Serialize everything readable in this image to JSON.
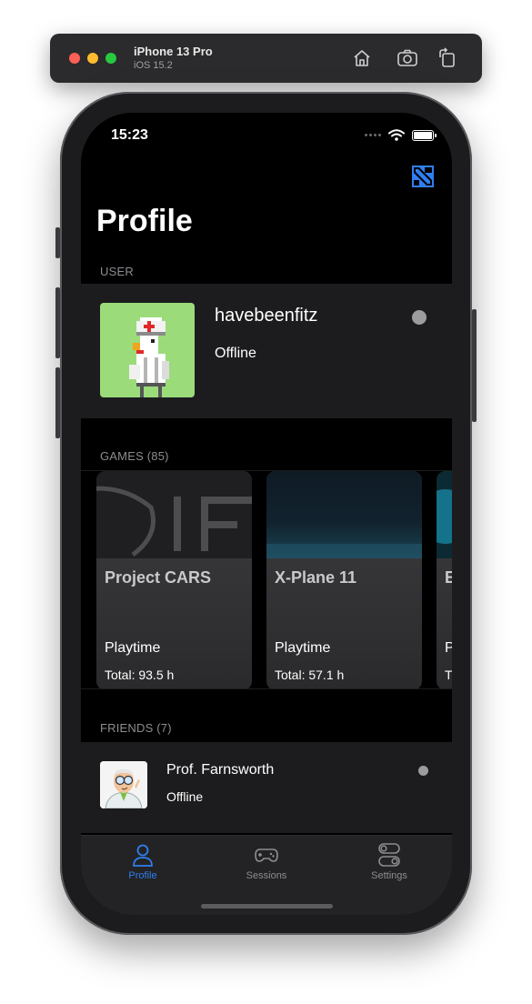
{
  "simulator": {
    "device_name": "iPhone 13 Pro",
    "os_version": "iOS 15.2",
    "buttons": [
      "home-icon",
      "screenshot-icon",
      "rotate-icon"
    ]
  },
  "status_bar": {
    "time": "15:23"
  },
  "page": {
    "title": "Profile"
  },
  "user_section": {
    "header": "USER",
    "name": "havebeenfitz",
    "status": "Offline"
  },
  "games_section": {
    "header": "GAMES (85)",
    "cards": [
      {
        "title": "Project CARS",
        "label": "Playtime",
        "total": "Total: 93.5 h"
      },
      {
        "title": "X-Plane 11",
        "label": "Playtime",
        "total": "Total: 57.1 h"
      },
      {
        "title": "E",
        "label": "P",
        "total": "T"
      }
    ]
  },
  "friends_section": {
    "header": "FRIENDS (7)",
    "items": [
      {
        "name": "Prof. Farnsworth",
        "status": "Offline"
      }
    ]
  },
  "tab_bar": {
    "tabs": [
      {
        "label": "Profile",
        "icon": "person-icon",
        "active": true
      },
      {
        "label": "Sessions",
        "icon": "gamepad-icon",
        "active": false
      },
      {
        "label": "Settings",
        "icon": "toggles-icon",
        "active": false
      }
    ]
  },
  "colors": {
    "accent": "#2f7ff2",
    "status_offline": "#9c9c9e",
    "background": "#000000",
    "card": "#1c1c1e"
  }
}
